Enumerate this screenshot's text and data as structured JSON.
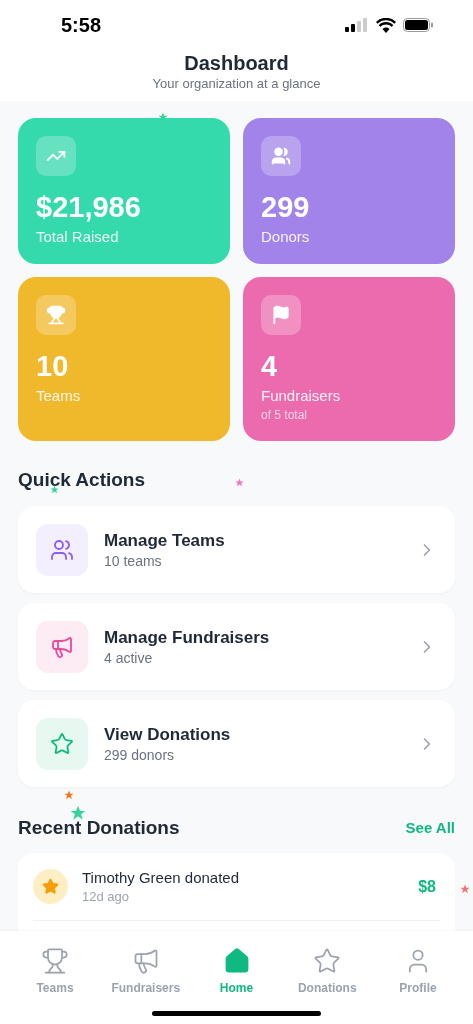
{
  "status_bar": {
    "time": "5:58"
  },
  "header": {
    "title": "Dashboard",
    "subtitle": "Your organization at a glance"
  },
  "stats": [
    {
      "kind": "trend",
      "value": "$21,986",
      "label": "Total Raised",
      "color": "#34d9ac"
    },
    {
      "kind": "users",
      "value": "299",
      "label": "Donors",
      "color": "#a283e9"
    },
    {
      "kind": "trophy",
      "value": "10",
      "label": "Teams",
      "color": "#f0b92b"
    },
    {
      "kind": "flag",
      "value": "4",
      "label": "Fundraisers",
      "note": "of 5 total",
      "color": "#ec6bae"
    }
  ],
  "quick_actions": {
    "title": "Quick Actions",
    "items": [
      {
        "kind": "teams",
        "title": "Manage Teams",
        "subtitle": "10 teams"
      },
      {
        "kind": "fundraisers",
        "title": "Manage Fundraisers",
        "subtitle": "4 active"
      },
      {
        "kind": "donations",
        "title": "View Donations",
        "subtitle": "299 donors"
      }
    ]
  },
  "recent_donations": {
    "title": "Recent Donations",
    "link": "See All",
    "items": [
      {
        "title": "Timothy Green donated",
        "time": "12d ago",
        "amount": "$8"
      }
    ]
  },
  "confetti": [
    {
      "color": "#34d399"
    },
    {
      "color": "#f472b6"
    },
    {
      "color": "#34d399"
    },
    {
      "color": "#f97316"
    },
    {
      "color": "#34d399"
    },
    {
      "color": "#f87171"
    }
  ],
  "tab_bar": [
    {
      "kind": "trophy",
      "label": "Teams",
      "selected": false
    },
    {
      "kind": "megaphone",
      "label": "Fundraisers",
      "selected": false
    },
    {
      "kind": "home",
      "label": "Home",
      "selected": true
    },
    {
      "kind": "star",
      "label": "Donations",
      "selected": false
    },
    {
      "kind": "user",
      "label": "Profile",
      "selected": false
    }
  ]
}
